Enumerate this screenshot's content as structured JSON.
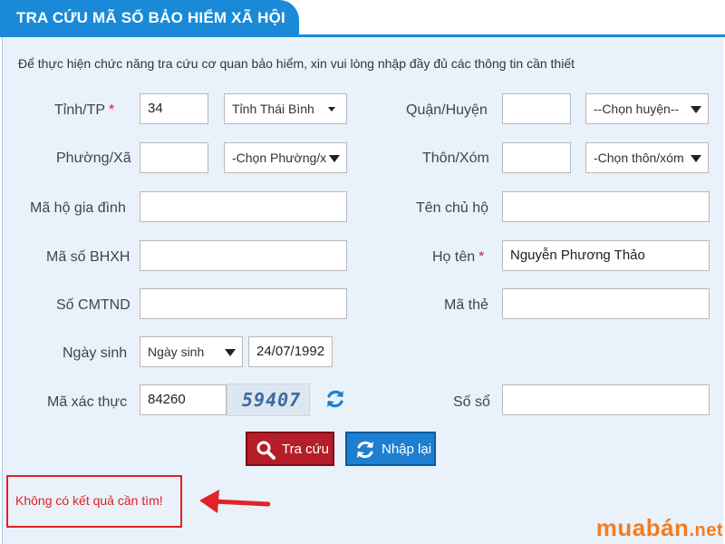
{
  "tab_title": "TRA CỨU MÃ SỐ BẢO HIỂM XÃ HỘI",
  "instruction": "Để thực hiện chức năng tra cứu cơ quan bảo hiểm, xin vui lòng nhập đầy đủ các thông tin cần thiết",
  "required_mark": "*",
  "fields": {
    "tinh": {
      "label": "Tỉnh/TP",
      "value": "34",
      "select": "Tỉnh Thái Bình"
    },
    "quan": {
      "label": "Quận/Huyện",
      "value": "",
      "select": "--Chọn huyện--"
    },
    "phuong": {
      "label": "Phường/Xã",
      "value": "",
      "select": "-Chọn Phường/x"
    },
    "thon": {
      "label": "Thôn/Xóm",
      "value": "",
      "select": "-Chọn thôn/xóm"
    },
    "ma_ho": {
      "label": "Mã hộ gia đình",
      "value": ""
    },
    "ten_chu_ho": {
      "label": "Tên chủ hộ",
      "value": ""
    },
    "ma_bhxh": {
      "label": "Mã số BHXH",
      "value": ""
    },
    "ho_ten": {
      "label": "Họ tên",
      "value": "Nguyễn Phương Thảo"
    },
    "cmtnd": {
      "label": "Số CMTND",
      "value": ""
    },
    "ma_the": {
      "label": "Mã thẻ",
      "value": ""
    },
    "ngay_sinh": {
      "label": "Ngày sinh",
      "select": "Ngày sinh",
      "value": "24/07/1992"
    },
    "ma_xac_thuc": {
      "label": "Mã xác thực",
      "value": "84260",
      "captcha": "59407"
    },
    "so_so": {
      "label": "Số sổ",
      "value": ""
    }
  },
  "buttons": {
    "search": "Tra cứu",
    "reset": "Nhập lại"
  },
  "result_message": "Không có kết quả cần tìm!",
  "watermark": {
    "brand": "muabán",
    "tld": ".net"
  },
  "colors": {
    "header_blue": "#1a8ad8",
    "panel_bg": "#e9f2fb",
    "search_red": "#b51e28",
    "reset_blue": "#1d7fd0",
    "error_red": "#e32227",
    "watermark_orange": "#f47c1f"
  }
}
